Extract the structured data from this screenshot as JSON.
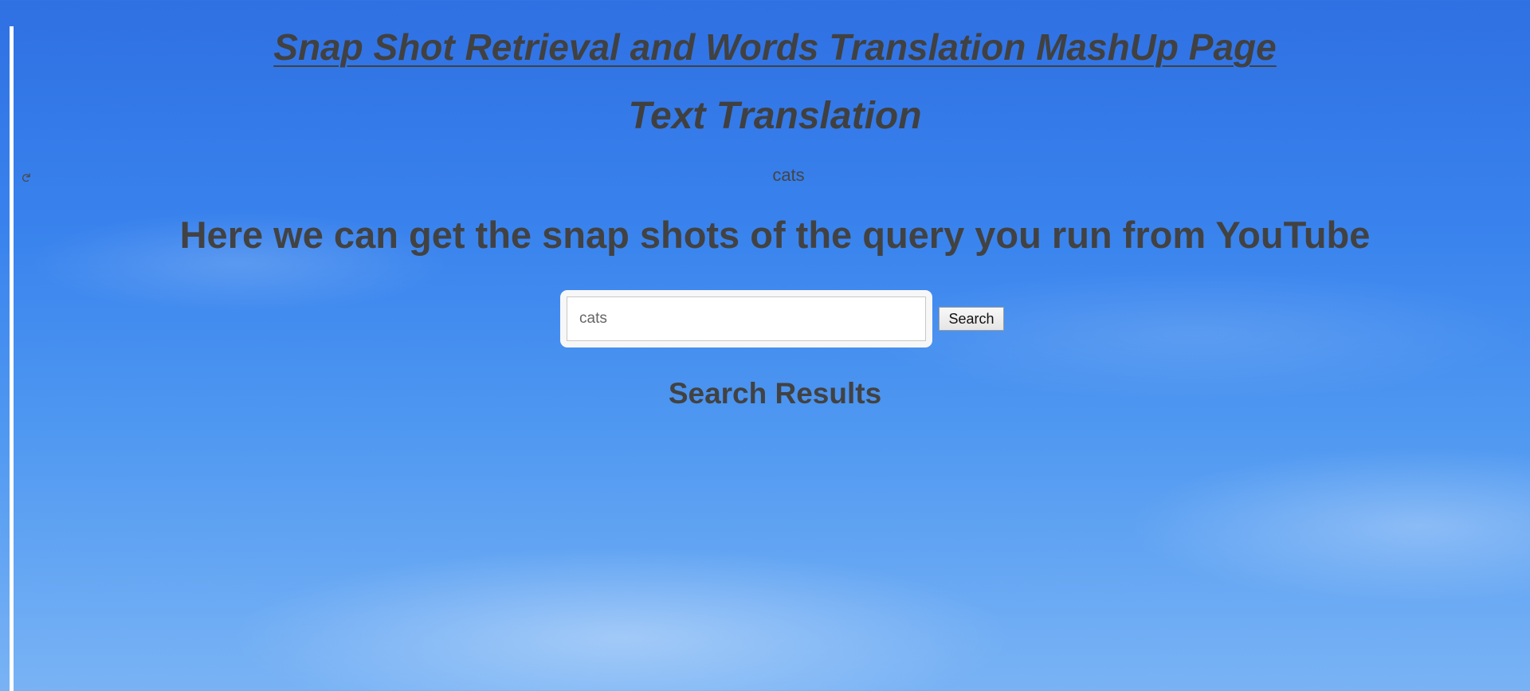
{
  "page": {
    "title": "Snap Shot Retrieval and Words Translation MashUp Page",
    "side_icon": "refresh-icon"
  },
  "translation": {
    "heading": "Text Translation",
    "output_text": "cats"
  },
  "snapshot_search": {
    "heading": "Here we can get the snap shots of the query you run from YouTube",
    "input_value": "cats",
    "button_label": "Search"
  },
  "results": {
    "heading": "Search Results",
    "items": []
  },
  "colors": {
    "background_top": "#2f70e3",
    "background_bottom": "#79b3f5",
    "text": "#444444",
    "panel": "#f7f7f7"
  }
}
